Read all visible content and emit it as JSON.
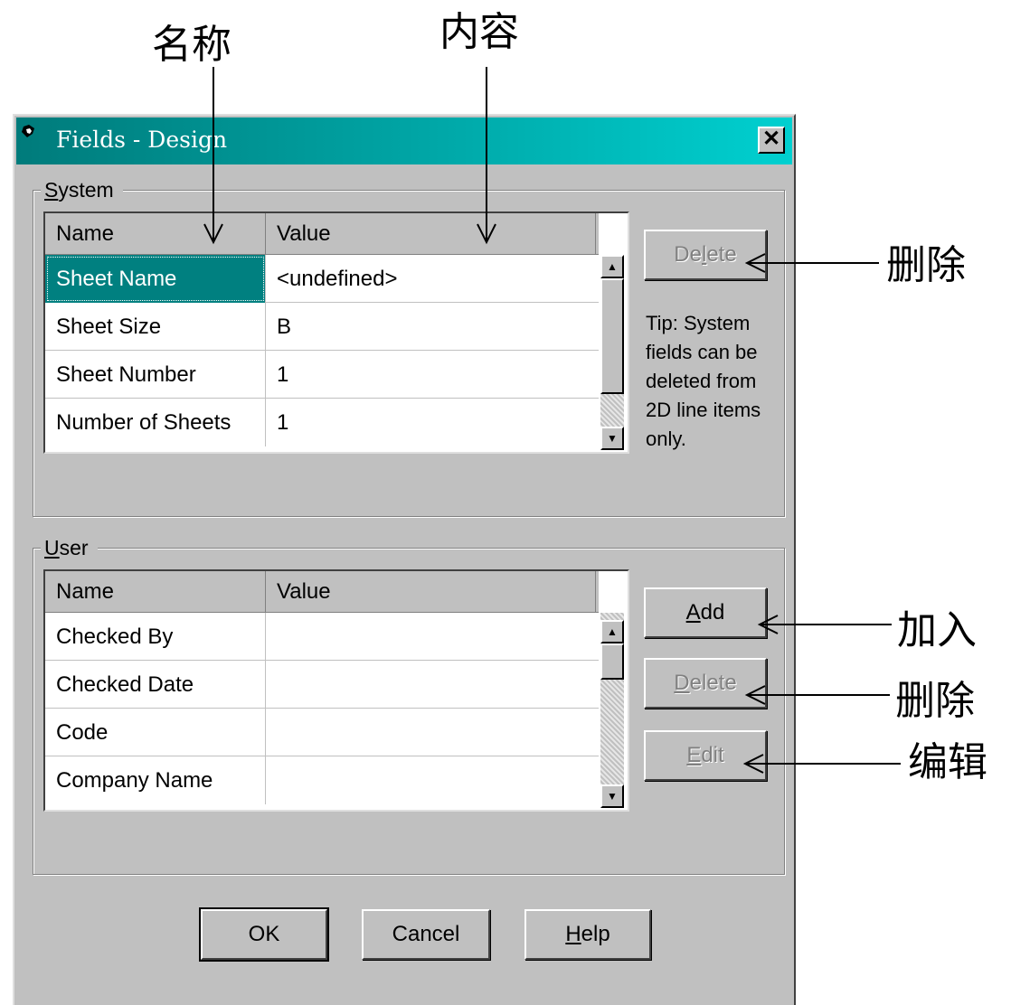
{
  "annotations": {
    "name_label": "名称",
    "content_label": "内容",
    "system_delete_label": "删除",
    "add_label": "加入",
    "user_delete_label": "删除",
    "edit_label": "编辑"
  },
  "window": {
    "title": "Fields - Design",
    "close_glyph": "✕",
    "titlebar_color": "#008080"
  },
  "system_group": {
    "label_accel": "S",
    "label_rest": "ystem",
    "columns": [
      "Name",
      "Value"
    ],
    "rows": [
      {
        "name": "Sheet Name",
        "value": "<undefined>",
        "selected": true
      },
      {
        "name": "Sheet Size",
        "value": "B"
      },
      {
        "name": "Sheet Number",
        "value": "1"
      },
      {
        "name": "Number of Sheets",
        "value": "1"
      }
    ],
    "delete_button": {
      "pre": "De",
      "accel": "l",
      "post": "ete",
      "disabled": true
    },
    "tip": "Tip: System fields can be deleted from 2D line items only."
  },
  "user_group": {
    "label_accel": "U",
    "label_rest": "ser",
    "columns": [
      "Name",
      "Value"
    ],
    "rows": [
      {
        "name": "Checked By",
        "value": ""
      },
      {
        "name": "Checked Date",
        "value": ""
      },
      {
        "name": "Code",
        "value": ""
      },
      {
        "name": "Company Name",
        "value": ""
      }
    ],
    "add_button": {
      "pre": "",
      "accel": "A",
      "post": "dd",
      "disabled": false
    },
    "delete_button": {
      "pre": "",
      "accel": "D",
      "post": "elete",
      "disabled": true
    },
    "edit_button": {
      "pre": "",
      "accel": "E",
      "post": "dit",
      "disabled": true
    }
  },
  "footer": {
    "ok": "OK",
    "cancel": "Cancel",
    "help_accel": "H",
    "help_rest": "elp"
  },
  "icons": {
    "scroll_up": "▲",
    "scroll_down": "▼"
  }
}
